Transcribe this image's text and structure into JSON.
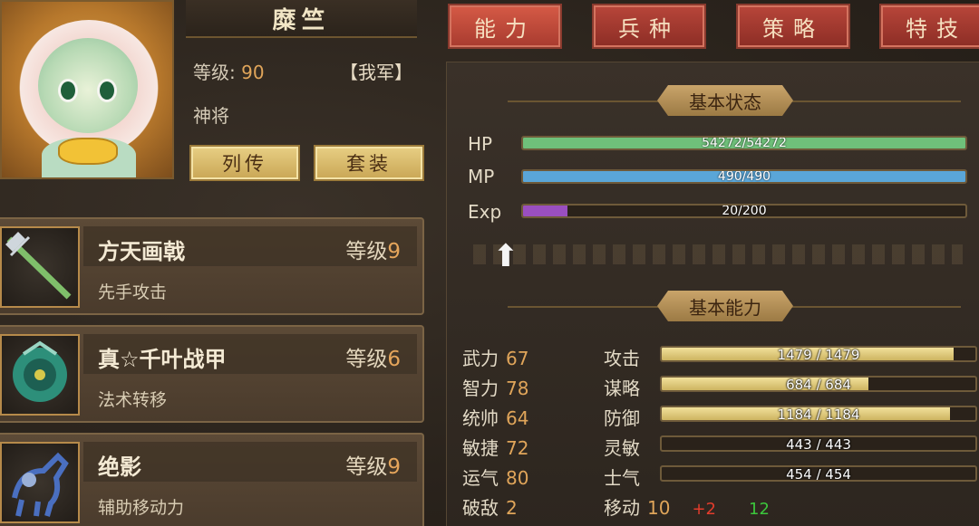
{
  "hero": {
    "name": "糜竺",
    "level_label": "等级:",
    "level": "90",
    "faction": "【我军】",
    "rank": "神将",
    "buttons": {
      "biography": "列传",
      "set": "套装"
    }
  },
  "equipment": [
    {
      "name": "方天画戟",
      "level_label": "等级",
      "level": "9",
      "effect": "先手攻击",
      "icon": "halberd-icon"
    },
    {
      "name": "真☆千叶战甲",
      "level_label": "等级",
      "level": "6",
      "effect": "法术转移",
      "icon": "armor-icon"
    },
    {
      "name": "绝影",
      "level_label": "等级",
      "level": "9",
      "effect": "辅助移动力",
      "icon": "horse-icon"
    }
  ],
  "tabs": [
    {
      "label": "能力",
      "active": true
    },
    {
      "label": "兵种",
      "active": false
    },
    {
      "label": "策略",
      "active": false
    },
    {
      "label": "特技",
      "active": false
    }
  ],
  "basic_status": {
    "title": "基本状态",
    "bars": [
      {
        "label": "HP",
        "text": "54272/54272",
        "fraction": 1.0,
        "color": "#6fc07a"
      },
      {
        "label": "MP",
        "text": "490/490",
        "fraction": 1.0,
        "color": "#5aa6d8"
      },
      {
        "label": "Exp",
        "text": "20/200",
        "fraction": 0.1,
        "color": "#9a4fc0"
      }
    ]
  },
  "basic_ability": {
    "title": "基本能力",
    "attributes": [
      {
        "label": "武力",
        "value": "67"
      },
      {
        "label": "智力",
        "value": "78"
      },
      {
        "label": "统帅",
        "value": "64"
      },
      {
        "label": "敏捷",
        "value": "72"
      },
      {
        "label": "运气",
        "value": "80"
      },
      {
        "label": "破敌",
        "value": "2"
      }
    ],
    "combat": [
      {
        "label": "攻击",
        "text": "1479 / 1479",
        "fraction": 0.93
      },
      {
        "label": "谋略",
        "text": "684 / 684",
        "fraction": 0.66
      },
      {
        "label": "防御",
        "text": "1184 / 1184",
        "fraction": 0.92
      },
      {
        "label": "灵敏",
        "text": "443 / 443",
        "fraction": 0.0
      },
      {
        "label": "士气",
        "text": "454 / 454",
        "fraction": 0.0
      }
    ],
    "move": {
      "label": "移动",
      "value": "10",
      "bonus": "+2",
      "total": "12"
    }
  },
  "colors": {
    "accent_gold": "#e0a55a",
    "tab_red": "#a83b2f",
    "bonus_red": "#e33c2c",
    "bonus_green": "#3cc63c"
  }
}
